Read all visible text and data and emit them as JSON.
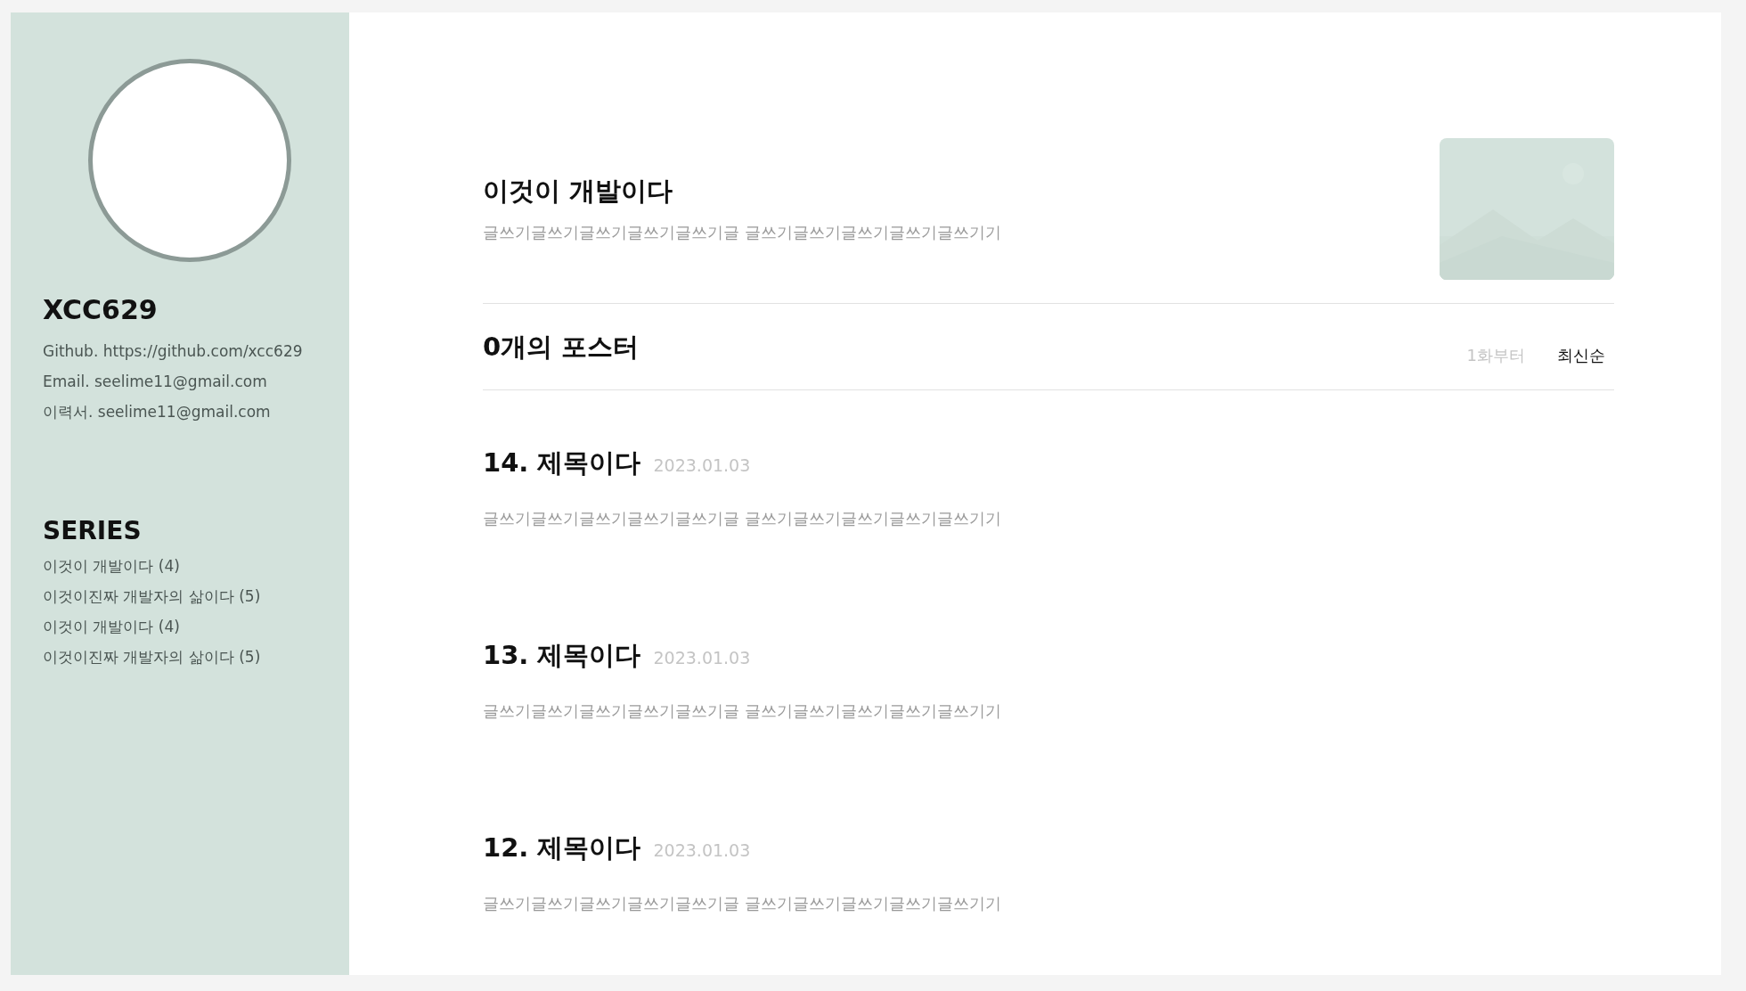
{
  "profile": {
    "name": "XCC629",
    "links": [
      "Github. https://github.com/xcc629",
      "Email. seelime11@gmail.com",
      "이력서. seelime11@gmail.com"
    ]
  },
  "series_nav": {
    "heading": "SERIES",
    "items": [
      "이것이 개발이다 (4)",
      "이것이진짜 개발자의 삶이다 (5)",
      "이것이 개발이다 (4)",
      "이것이진짜 개발자의 삶이다 (5)"
    ]
  },
  "series": {
    "title": "이것이 개발이다",
    "description": "글쓰기글쓰기글쓰기글쓰기글쓰기글 글쓰기글쓰기글쓰기글쓰기글쓰기기"
  },
  "posts_header": {
    "count": "0개의 포스터",
    "sort_options": [
      {
        "label": "1화부터",
        "selected": false
      },
      {
        "label": "최신순",
        "selected": true
      }
    ]
  },
  "posts": [
    {
      "title": "14. 제목이다",
      "date": "2023.01.03",
      "excerpt": "글쓰기글쓰기글쓰기글쓰기글쓰기글 글쓰기글쓰기글쓰기글쓰기글쓰기기"
    },
    {
      "title": "13. 제목이다",
      "date": "2023.01.03",
      "excerpt": "글쓰기글쓰기글쓰기글쓰기글쓰기글 글쓰기글쓰기글쓰기글쓰기글쓰기기"
    },
    {
      "title": "12. 제목이다",
      "date": "2023.01.03",
      "excerpt": "글쓰기글쓰기글쓰기글쓰기글쓰기글 글쓰기글쓰기글쓰기글쓰기글쓰기기"
    }
  ]
}
